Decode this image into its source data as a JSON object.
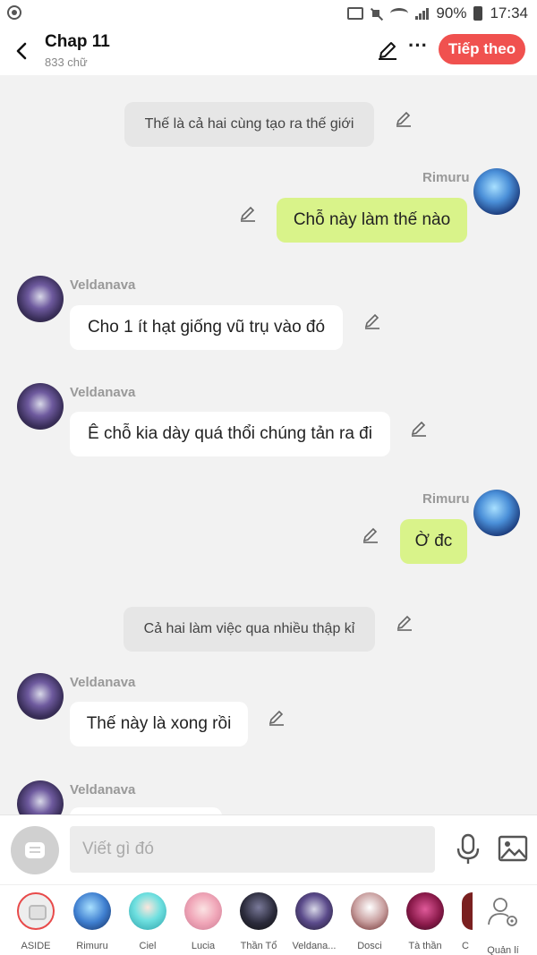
{
  "status_bar": {
    "battery": "90%",
    "time": "17:34"
  },
  "header": {
    "title": "Chap 11",
    "subtitle": "833 chữ",
    "next_label": "Tiếp theo"
  },
  "messages": [
    {
      "type": "narration",
      "text": "Thế là cả hai cùng tạo ra thế giới"
    },
    {
      "type": "right",
      "name": "Rimuru",
      "text": "Chỗ này làm thế nào"
    },
    {
      "type": "left",
      "name": "Veldanava",
      "text": "Cho 1 ít hạt giống vũ trụ vào đó"
    },
    {
      "type": "left",
      "name": "Veldanava",
      "text": "Ê chỗ kia dày quá thổi chúng tản ra đi"
    },
    {
      "type": "right",
      "name": "Rimuru",
      "text": "Ờ đc"
    },
    {
      "type": "narration",
      "text": "Cả hai làm việc qua nhiều thập kỉ"
    },
    {
      "type": "left",
      "name": "Veldanava",
      "text": "Thế này là xong rồi"
    },
    {
      "type": "left",
      "name": "Veldanava",
      "text": ""
    }
  ],
  "input": {
    "placeholder": "Viết gì đó"
  },
  "characters": [
    {
      "label": "ASIDE"
    },
    {
      "label": "Rimuru",
      "color": "#3f7fd0"
    },
    {
      "label": "Ciel",
      "color": "#49c9c9"
    },
    {
      "label": "Lucia",
      "color": "#f0a6b8"
    },
    {
      "label": "Thần Tổ",
      "color": "#2a2a3a"
    },
    {
      "label": "Veldana...",
      "color": "#5a4a8a"
    },
    {
      "label": "Dosci",
      "color": "#c9a0a0"
    },
    {
      "label": "Tà thần",
      "color": "#8a1a4a"
    },
    {
      "label": "C",
      "color": "#7a2020"
    },
    {
      "label": "Quản lí"
    }
  ],
  "icons": {
    "back": "back-arrow-icon",
    "pen": "pen-icon",
    "more": "more-icon",
    "mic": "microphone-icon",
    "image": "image-icon",
    "manage": "manage-user-icon"
  }
}
